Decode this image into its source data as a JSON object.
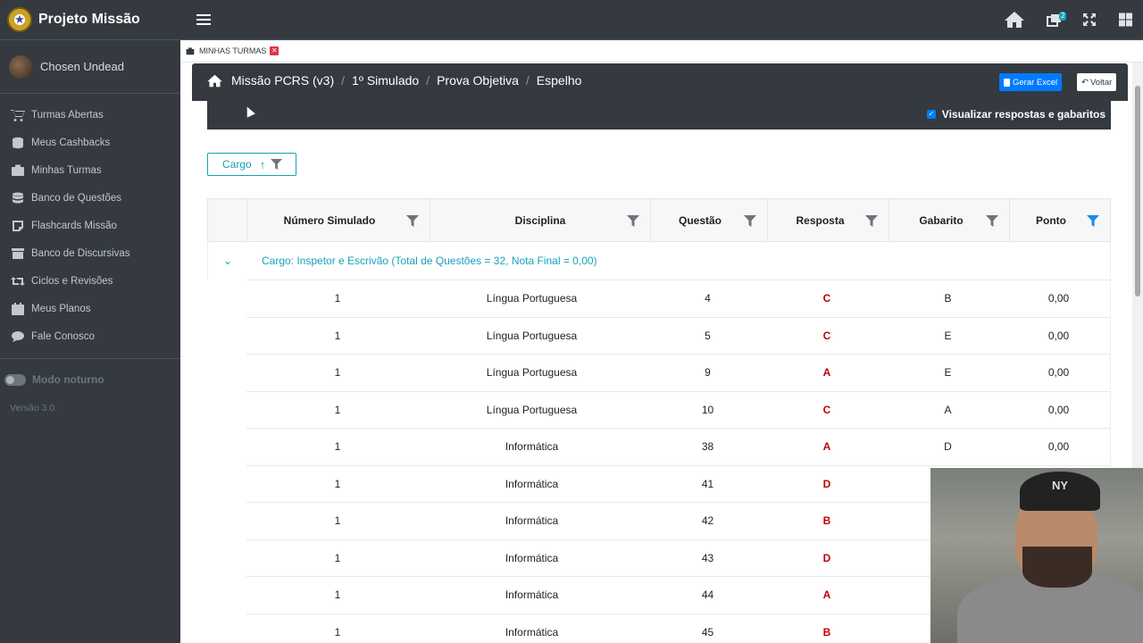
{
  "sidebar": {
    "brand": "Projeto Missão",
    "user": "Chosen Undead",
    "items": [
      {
        "label": "Turmas Abertas",
        "icon": "cart-icon"
      },
      {
        "label": "Meus Cashbacks",
        "icon": "coins-icon"
      },
      {
        "label": "Minhas Turmas",
        "icon": "briefcase-icon"
      },
      {
        "label": "Banco de Questões",
        "icon": "database-icon"
      },
      {
        "label": "Flashcards Missão",
        "icon": "note-icon"
      },
      {
        "label": "Banco de Discursivas",
        "icon": "archive-icon"
      },
      {
        "label": "Ciclos e Revisões",
        "icon": "retweet-icon"
      },
      {
        "label": "Meus Planos",
        "icon": "calendar-icon"
      },
      {
        "label": "Fale Conosco",
        "icon": "chat-icon"
      }
    ],
    "night_mode": "Modo noturno",
    "version": "Versão 3.0"
  },
  "topnav": {
    "badge": "2"
  },
  "tab": {
    "label": "MINHAS TURMAS"
  },
  "breadcrumb": [
    "Missão PCRS (v3)",
    "1º Simulado",
    "Prova Objetiva",
    "Espelho"
  ],
  "buttons": {
    "excel": "Gerar Excel",
    "back": "Voltar"
  },
  "show_answers_label": "Visualizar respostas e gabaritos",
  "group_chip": "Cargo",
  "grid": {
    "columns": [
      "Número Simulado",
      "Disciplina",
      "Questão",
      "Resposta",
      "Gabarito",
      "Ponto"
    ],
    "group_label": "Cargo: Inspetor e Escrivão (Total de Questões = 32, Nota Final = 0,00)",
    "rows": [
      {
        "num": "1",
        "disc": "Língua Portuguesa",
        "q": "4",
        "resp": "C",
        "gab": "B",
        "ponto": "0,00"
      },
      {
        "num": "1",
        "disc": "Língua Portuguesa",
        "q": "5",
        "resp": "C",
        "gab": "E",
        "ponto": "0,00"
      },
      {
        "num": "1",
        "disc": "Língua Portuguesa",
        "q": "9",
        "resp": "A",
        "gab": "E",
        "ponto": "0,00"
      },
      {
        "num": "1",
        "disc": "Língua Portuguesa",
        "q": "10",
        "resp": "C",
        "gab": "A",
        "ponto": "0,00"
      },
      {
        "num": "1",
        "disc": "Informática",
        "q": "38",
        "resp": "A",
        "gab": "D",
        "ponto": "0,00"
      },
      {
        "num": "1",
        "disc": "Informática",
        "q": "41",
        "resp": "D",
        "gab": "",
        "ponto": ""
      },
      {
        "num": "1",
        "disc": "Informática",
        "q": "42",
        "resp": "B",
        "gab": "",
        "ponto": ""
      },
      {
        "num": "1",
        "disc": "Informática",
        "q": "43",
        "resp": "D",
        "gab": "",
        "ponto": ""
      },
      {
        "num": "1",
        "disc": "Informática",
        "q": "44",
        "resp": "A",
        "gab": "",
        "ponto": ""
      },
      {
        "num": "1",
        "disc": "Informática",
        "q": "45",
        "resp": "B",
        "gab": "",
        "ponto": ""
      }
    ]
  }
}
